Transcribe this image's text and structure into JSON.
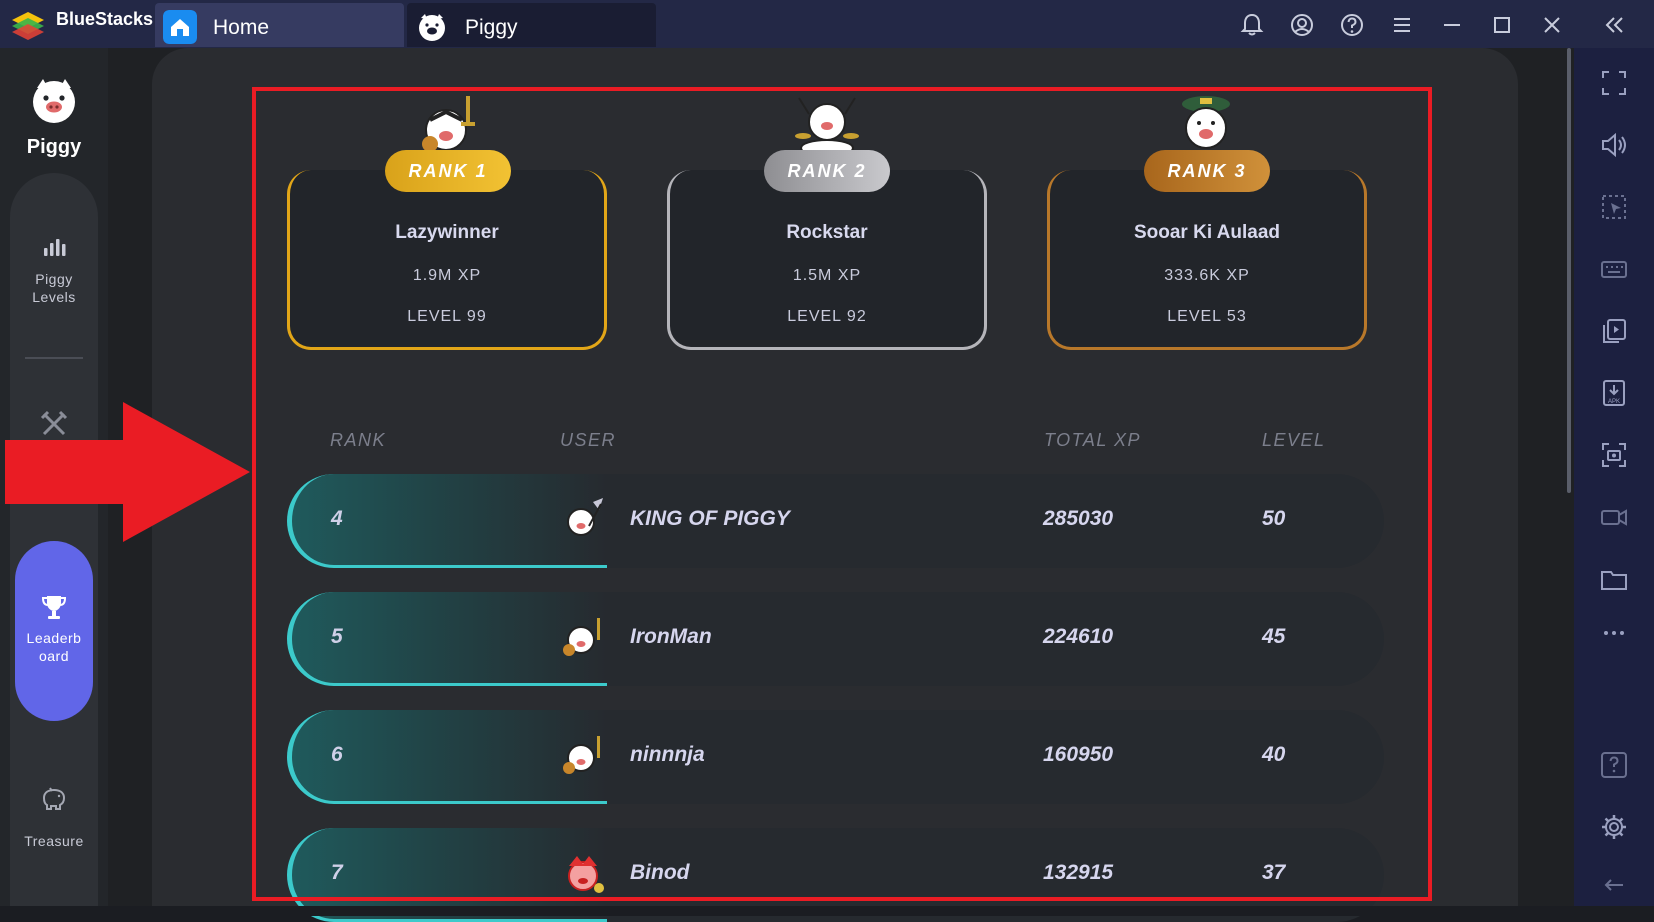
{
  "titlebar": {
    "app_name": "BlueStacks",
    "tabs": [
      {
        "label": "Home",
        "icon": "home-icon"
      },
      {
        "label": "Piggy",
        "icon": "piggy-icon"
      }
    ],
    "buttons": [
      "bell-icon",
      "account-icon",
      "help-icon",
      "menu-icon",
      "minimize-icon",
      "maximize-icon",
      "close-icon",
      "collapse-sidebar-icon"
    ]
  },
  "sidebar": {
    "brand": "Piggy",
    "items": [
      {
        "label": "Piggy\nLevels",
        "icon": "bar-chart-icon"
      },
      {
        "label": "",
        "icon": "swords-icon"
      },
      {
        "label": "Leaderb\noard",
        "icon": "trophy-icon",
        "active": true
      },
      {
        "label": "Treasure",
        "icon": "piggy-bank-icon"
      }
    ]
  },
  "podium": [
    {
      "badge": "RANK 1",
      "name": "Lazywinner",
      "xp": "1.9M XP",
      "level": "LEVEL 99",
      "color": "#e2a618"
    },
    {
      "badge": "RANK 2",
      "name": "Rockstar",
      "xp": "1.5M XP",
      "level": "LEVEL 92",
      "color": "#9a9a9e"
    },
    {
      "badge": "RANK 3",
      "name": "Sooar Ki Aulaad",
      "xp": "333.6K XP",
      "level": "LEVEL 53",
      "color": "#b8782a"
    }
  ],
  "table": {
    "headers": {
      "rank": "RANK",
      "user": "USER",
      "xp": "TOTAL XP",
      "level": "LEVEL"
    },
    "rows": [
      {
        "rank": "4",
        "user": "KING OF PIGGY",
        "xp": "285030",
        "level": "50"
      },
      {
        "rank": "5",
        "user": "IronMan",
        "xp": "224610",
        "level": "45"
      },
      {
        "rank": "6",
        "user": "ninnnja",
        "xp": "160950",
        "level": "40"
      },
      {
        "rank": "7",
        "user": "Binod",
        "xp": "132915",
        "level": "37"
      }
    ]
  },
  "rightbar": {
    "buttons": [
      "fullscreen-icon",
      "volume-icon",
      "select-icon",
      "keyboard-icon",
      "multi-instance-icon",
      "apk-install-icon",
      "screenshot-icon",
      "record-icon",
      "folder-icon",
      "more-icon",
      "help-icon",
      "settings-icon",
      "back-icon"
    ]
  },
  "colors": {
    "accent": "#6166e8",
    "highlight": "#ea1c24",
    "row_accent": "#3ccacb"
  }
}
